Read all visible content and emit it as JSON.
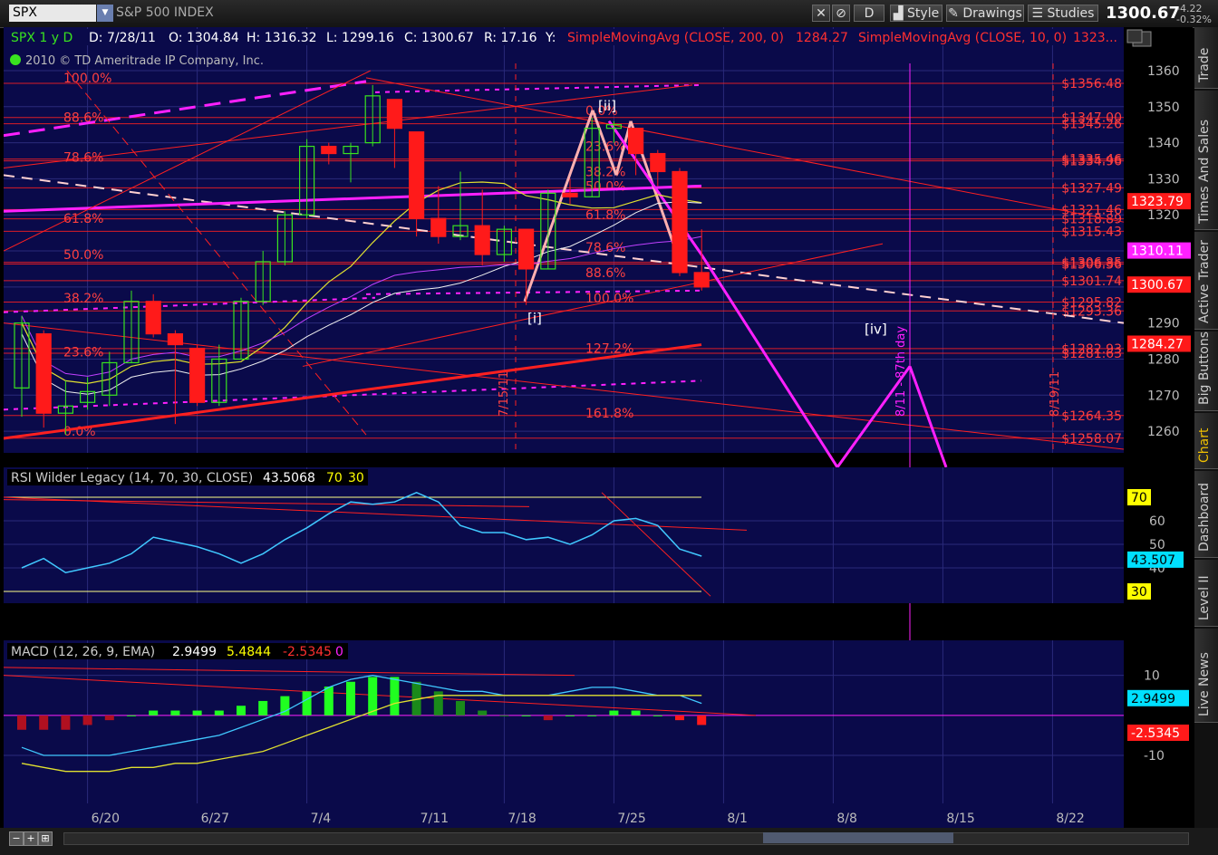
{
  "toolbar": {
    "symbol": "SPX",
    "symbol_name": "S&P 500 INDEX",
    "d_button": "D",
    "style_label": "Style",
    "drawings_label": "Drawings",
    "studies_label": "Studies",
    "last_price": "1300.67",
    "change": "-4.22",
    "change_pct": "-0.32%"
  },
  "header": {
    "symbol_period": "SPX 1 y D",
    "date": "D: 7/28/11",
    "open": "O: 1304.84",
    "high": "H: 1316.32",
    "low": "L: 1299.16",
    "close": "C: 1300.67",
    "range": "R: 17.16",
    "yield": "Y:",
    "sma200": "SimpleMovingAvg (CLOSE, 200, 0)",
    "sma200_val": "1284.27",
    "sma10": "SimpleMovingAvg (CLOSE, 10, 0)",
    "sma10_val": "1323...",
    "copyright": "2010 © TD Ameritrade IP Company, Inc."
  },
  "side_tabs": [
    "Trade",
    "Times And Sales",
    "Active Trader",
    "Big Buttons",
    "Chart",
    "Dashboard",
    "Level II",
    "Live News"
  ],
  "colors": {
    "bull": "#39e31f",
    "bear": "#ff1a1a",
    "magenta": "#ff20ff",
    "pink": "#ffb0b0",
    "red_line": "#ff2020",
    "grid": "#2a2a7a",
    "panel_bg": "#0a0a4a"
  },
  "chart_data": [
    {
      "type": "candlestick",
      "panel": "price",
      "x_dates": [
        "6/14",
        "6/15",
        "6/16",
        "6/17",
        "6/20",
        "6/21",
        "6/22",
        "6/23",
        "6/24",
        "6/27",
        "6/28",
        "6/29",
        "6/30",
        "7/1",
        "7/5",
        "7/6",
        "7/7",
        "7/8",
        "7/11",
        "7/12",
        "7/13",
        "7/14",
        "7/15",
        "7/18",
        "7/19",
        "7/20",
        "7/21",
        "7/22",
        "7/25",
        "7/26",
        "7/27",
        "7/28"
      ],
      "ohlc": [
        [
          1272,
          1292,
          1264,
          1290
        ],
        [
          1287,
          1288,
          1261,
          1265
        ],
        [
          1265,
          1274,
          1259,
          1267
        ],
        [
          1268,
          1275,
          1266,
          1271
        ],
        [
          1270,
          1282,
          1267,
          1279
        ],
        [
          1279,
          1299,
          1279,
          1296
        ],
        [
          1296,
          1298,
          1286,
          1287
        ],
        [
          1287,
          1288,
          1262,
          1284
        ],
        [
          1283,
          1284,
          1267,
          1268
        ],
        [
          1268,
          1284,
          1267,
          1280
        ],
        [
          1280,
          1297,
          1280,
          1296
        ],
        [
          1296,
          1310,
          1295,
          1307
        ],
        [
          1307,
          1321,
          1306,
          1320
        ],
        [
          1320,
          1341,
          1319,
          1339
        ],
        [
          1339,
          1340,
          1334,
          1337
        ],
        [
          1337,
          1340,
          1329,
          1339
        ],
        [
          1340,
          1356,
          1339,
          1353
        ],
        [
          1352,
          1352,
          1333,
          1344
        ],
        [
          1343,
          1343,
          1314,
          1319
        ],
        [
          1319,
          1328,
          1312,
          1314
        ],
        [
          1314,
          1332,
          1313,
          1317
        ],
        [
          1317,
          1327,
          1306,
          1309
        ],
        [
          1309,
          1317,
          1307,
          1316
        ],
        [
          1316,
          1316,
          1295,
          1305
        ],
        [
          1305,
          1327,
          1305,
          1326
        ],
        [
          1326,
          1330,
          1323,
          1325
        ],
        [
          1325,
          1347,
          1325,
          1344
        ],
        [
          1344,
          1346,
          1340,
          1345
        ],
        [
          1344,
          1344,
          1331,
          1337
        ],
        [
          1337,
          1338,
          1328,
          1332
        ],
        [
          1332,
          1333,
          1303,
          1304
        ],
        [
          1304,
          1316,
          1299,
          1300
        ]
      ],
      "extended_x": [
        "8/1",
        "8/8",
        "8/15",
        "8/22"
      ],
      "y_ticks": [
        1260,
        1270,
        1280,
        1290,
        1300,
        1310,
        1320,
        1330,
        1340,
        1350,
        1360
      ],
      "ylim": [
        1254,
        1362
      ],
      "horizontal_levels": [
        1356.48,
        1347,
        1345.26,
        1335.46,
        1334.96,
        1327.49,
        1321.46,
        1318.89,
        1315.43,
        1306.85,
        1306.36,
        1301.74,
        1295.82,
        1293.36,
        1282.93,
        1281.63,
        1264.35,
        1258.07
      ],
      "fib_left": [
        [
          "100.0%",
          1358
        ],
        [
          "88.6%",
          1347
        ],
        [
          "78.6%",
          1336
        ],
        [
          "61.8%",
          1319
        ],
        [
          "50.0%",
          1309
        ],
        [
          "38.2%",
          1297
        ],
        [
          "23.6%",
          1282
        ],
        [
          "0.0%",
          1260
        ]
      ],
      "fib_right": [
        [
          "0.0%",
          1349
        ],
        [
          "23.6%",
          1339
        ],
        [
          "38.2%",
          1332
        ],
        [
          "50.0%",
          1328
        ],
        [
          "61.8%",
          1320
        ],
        [
          "78.6%",
          1311
        ],
        [
          "88.6%",
          1304
        ],
        [
          "100.0%",
          1297
        ],
        [
          "127.2%",
          1283
        ],
        [
          "161.8%",
          1265
        ]
      ],
      "wave_labels": [
        "[i]",
        "[ii]",
        "[iv]"
      ],
      "annotations": [
        "7/15/11",
        "8/11 - 87th day",
        "8/19/11"
      ],
      "price_tags": [
        [
          "1323.79",
          1323.79,
          "#ff1a1a"
        ],
        [
          "1310.11",
          1310.11,
          "#ff20ff"
        ],
        [
          "1300.67",
          1300.67,
          "#ff1a1a"
        ],
        [
          "1284.27",
          1284.27,
          "#ff1a1a"
        ]
      ]
    },
    {
      "type": "line",
      "panel": "rsi",
      "title": "RSI Wilder Legacy (14, 70, 30, CLOSE)",
      "value_label": "43.5068",
      "ob": "70",
      "os": "30",
      "values": [
        40,
        44,
        38,
        40,
        42,
        46,
        53,
        51,
        49,
        46,
        42,
        46,
        52,
        57,
        63,
        68,
        67,
        68,
        72,
        68,
        58,
        55,
        55,
        52,
        53,
        50,
        54,
        60,
        61,
        58,
        48,
        45
      ],
      "y_ticks": [
        40,
        50,
        60
      ],
      "ylim": [
        25,
        75
      ],
      "price_tags": [
        [
          "70",
          "#ffff00"
        ],
        [
          "43.507",
          "#00e0ff"
        ],
        [
          "30",
          "#ffff00"
        ]
      ]
    },
    {
      "type": "bar",
      "panel": "macd",
      "title": "MACD (12, 26, 9, EMA)",
      "value_label": "2.9499",
      "avg_label": "5.4844",
      "diff_label": "-2.5345",
      "zero_label": "0",
      "macd": [
        -8,
        -10,
        -10,
        -10,
        -10,
        -9,
        -8,
        -7,
        -6,
        -5,
        -3,
        -1,
        1,
        4,
        7,
        9,
        10,
        9,
        8,
        7,
        6,
        6,
        5,
        5,
        5,
        6,
        7,
        7,
        6,
        5,
        5,
        3
      ],
      "signal": [
        -12,
        -13,
        -14,
        -14,
        -14,
        -13,
        -13,
        -12,
        -12,
        -11,
        -10,
        -9,
        -7,
        -5,
        -3,
        -1,
        1,
        3,
        4,
        5,
        5,
        5,
        5,
        5,
        5,
        5,
        5,
        5,
        5,
        5,
        5,
        5
      ],
      "hist": [
        -3,
        -3,
        -3,
        -2,
        -1,
        0,
        1,
        1,
        1,
        1,
        2,
        3,
        4,
        5,
        6,
        7,
        8,
        8,
        7,
        5,
        3,
        1,
        0,
        0,
        -1,
        0,
        0,
        1,
        1,
        0,
        -1,
        -2
      ],
      "y_ticks": [
        -10,
        10
      ],
      "ylim": [
        -22,
        14
      ],
      "price_tags": [
        [
          "2.9499",
          "#00e0ff"
        ],
        [
          "-2.5345",
          "#ff1a1a"
        ]
      ]
    }
  ]
}
